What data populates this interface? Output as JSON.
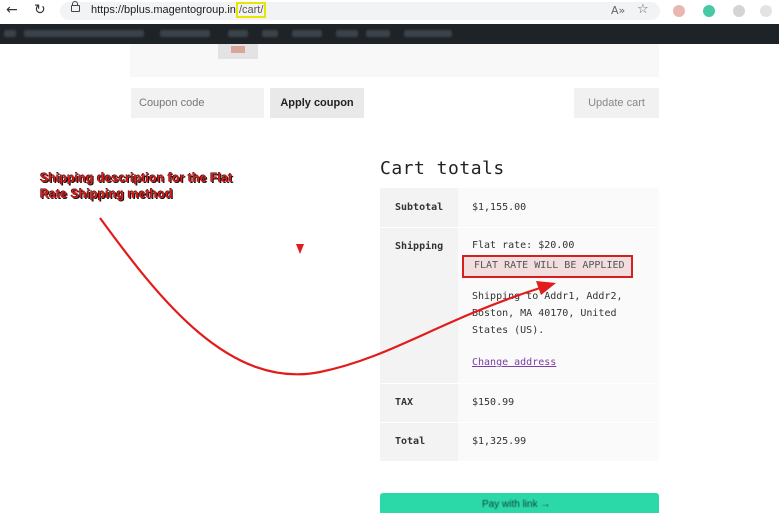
{
  "browser": {
    "url_host": "https://bplus.magentogroup.in",
    "url_path": "/cart/",
    "read_aloud_icon": "A»",
    "favorite_icon": "☆"
  },
  "coupon": {
    "placeholder": "Coupon code",
    "apply_label": "Apply coupon",
    "update_label": "Update cart"
  },
  "cart_totals": {
    "title": "Cart totals",
    "subtotal_label": "Subtotal",
    "subtotal_value": "$1,155.00",
    "shipping_label": "Shipping",
    "shipping_method": "Flat rate: $20.00",
    "shipping_description": "FLAT RATE WILL BE APPLIED",
    "shipping_to": "Shipping to Addr1, Addr2, Boston, MA 40170, United States (US).",
    "change_address": "Change address",
    "tax_label": "TAX",
    "tax_value": "$150.99",
    "total_label": "Total",
    "total_value": "$1,325.99"
  },
  "annotation": {
    "text": "Shipping description for the Flat Rate Shipping method"
  },
  "pay_button": {
    "label": "Pay with link →"
  },
  "colors": {
    "annotation_red": "#e21b1b",
    "pay_button": "#2bd9a8",
    "admin_bar": "#1d2327"
  }
}
